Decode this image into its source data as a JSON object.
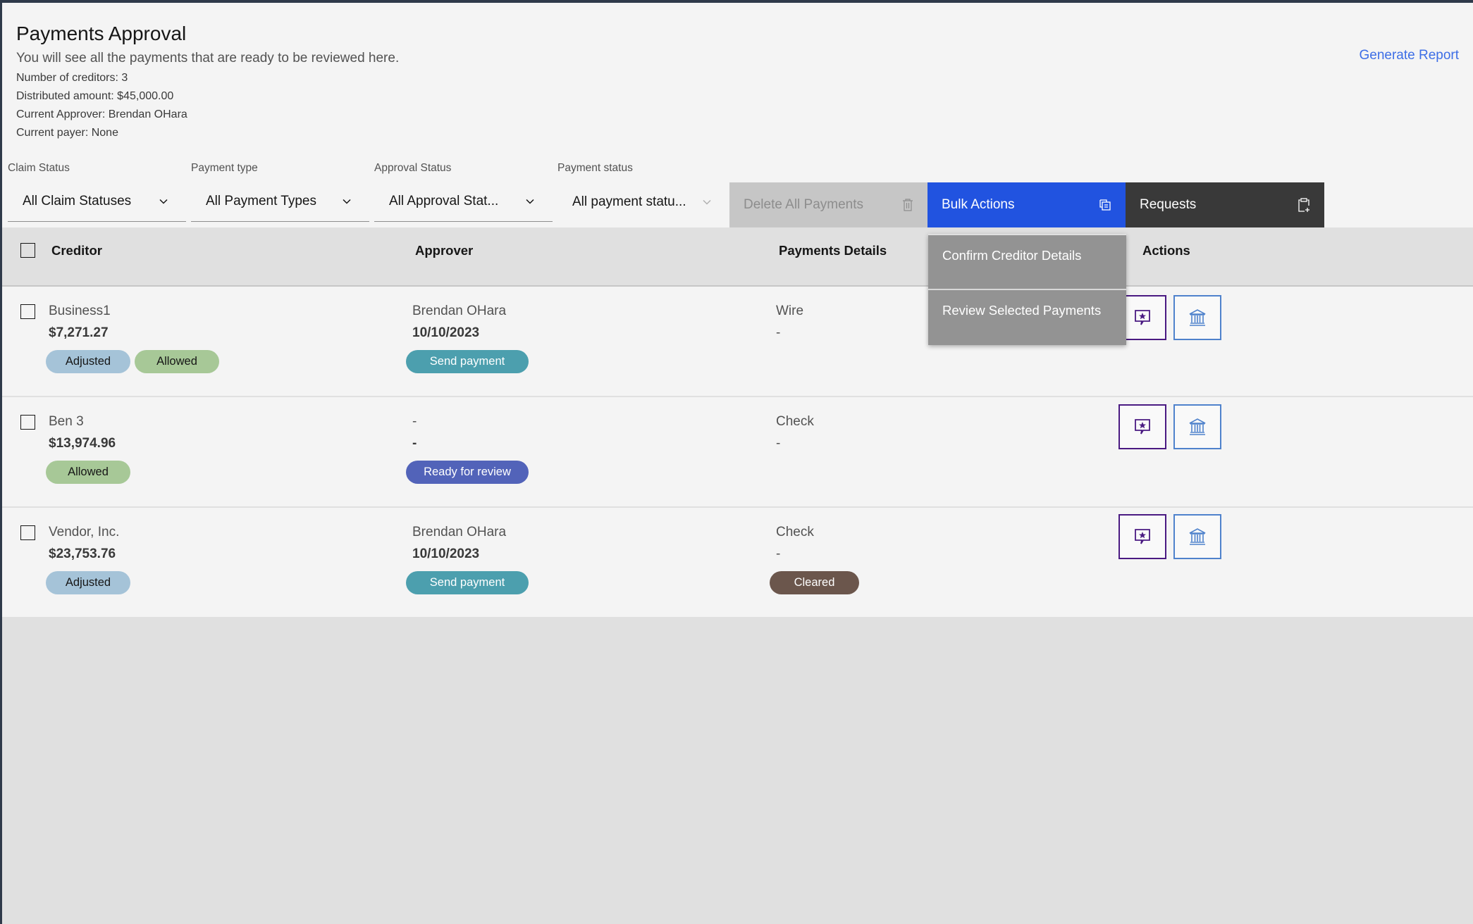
{
  "header": {
    "title": "Payments Approval",
    "subtitle": "You will see all the payments that are ready to be reviewed here.",
    "meta": [
      "Number of creditors: 3",
      "Distributed amount: $45,000.00",
      "Current Approver: Brendan OHara",
      "Current payer: None"
    ],
    "generate_report_label": "Generate Report"
  },
  "filters": [
    {
      "label": "Claim Status",
      "value": "All Claim Statuses"
    },
    {
      "label": "Payment type",
      "value": "All Payment Types"
    },
    {
      "label": "Approval Status",
      "value": "All Approval Stat..."
    },
    {
      "label": "Payment status",
      "value": "All payment statu..."
    }
  ],
  "toolbar": {
    "delete_label": "Delete All Payments",
    "bulk_label": "Bulk Actions",
    "requests_label": "Requests"
  },
  "bulk_menu": {
    "items": [
      "Confirm Creditor Details",
      "Review Selected Payments"
    ]
  },
  "table": {
    "columns": [
      "Creditor",
      "Approver",
      "Payments Details",
      "Actions"
    ],
    "rows": [
      {
        "creditor": "Business1",
        "amount": "$7,271.27",
        "tags": [
          "Adjusted",
          "Allowed"
        ],
        "approver": "Brendan OHara",
        "approver_date": "10/10/2023",
        "approval_status": "Send payment",
        "payment_method": "Wire",
        "payment_detail": "-",
        "payment_status": null
      },
      {
        "creditor": "Ben 3",
        "amount": "$13,974.96",
        "tags": [
          "Allowed"
        ],
        "approver": "-",
        "approver_date": "-",
        "approval_status": "Ready for review",
        "payment_method": "Check",
        "payment_detail": "-",
        "payment_status": null
      },
      {
        "creditor": "Vendor, Inc.",
        "amount": "$23,753.76",
        "tags": [
          "Adjusted"
        ],
        "approver": "Brendan OHara",
        "approver_date": "10/10/2023",
        "approval_status": "Send payment",
        "payment_method": "Check",
        "payment_detail": "-",
        "payment_status": "Cleared"
      }
    ]
  },
  "colors": {
    "accent_blue": "#2153e0",
    "link_blue": "#3d6ee6",
    "tag_adjusted": "#a5c3d8",
    "tag_allowed": "#a7c897",
    "tag_send_payment": "#4c9fae",
    "tag_ready_for_review": "#5263b9",
    "tag_cleared": "#6b564c"
  }
}
